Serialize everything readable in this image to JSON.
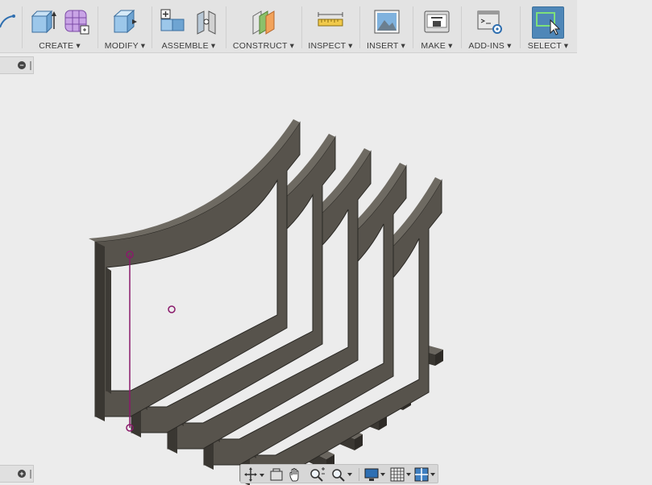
{
  "toolbar": {
    "groups": [
      {
        "label": "CREATE",
        "icon": "extrude-box-icon"
      },
      {
        "label": "MODIFY",
        "icon": "press-pull-icon"
      },
      {
        "label": "ASSEMBLE",
        "icon": "new-component-icon"
      },
      {
        "label": "CONSTRUCT",
        "icon": "offset-plane-icon"
      },
      {
        "label": "INSPECT",
        "icon": "measure-ruler-icon"
      },
      {
        "label": "INSERT",
        "icon": "insert-image-icon"
      },
      {
        "label": "MAKE",
        "icon": "3d-print-icon"
      },
      {
        "label": "ADD-INS",
        "icon": "scripts-gear-icon"
      },
      {
        "label": "SELECT",
        "icon": "select-cursor-icon"
      }
    ],
    "dropdown_glyph": "▾"
  },
  "panels": {
    "top_symbol": "−",
    "bottom_symbol": "+"
  },
  "colors": {
    "toolbar_bg": "#e3e3e3",
    "canvas_bg": "#ececec",
    "select_active": "#4f87b8",
    "model_face": "#57534c",
    "model_dark": "#3a3732",
    "selection_edge": "#8a1a6b"
  },
  "navbar": {
    "tools": [
      "orbit-icon",
      "look-at-icon",
      "pan-hand-icon",
      "zoom-icon",
      "fit-zoom-icon",
      "display-settings-icon",
      "grid-icon",
      "viewports-icon"
    ]
  }
}
